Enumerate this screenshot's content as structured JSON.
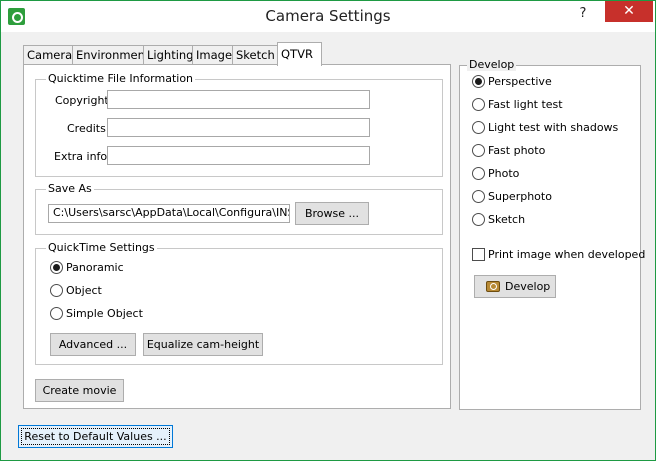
{
  "window": {
    "title": "Camera Settings",
    "help_label": "?",
    "close_label": "✕"
  },
  "tabs": [
    "Camera",
    "Environment",
    "Lighting",
    "Image",
    "Sketch",
    "QTVR"
  ],
  "qtvr": {
    "file_info": {
      "group_label": "Quicktime File Information",
      "copyright_label": "Copyright",
      "copyright_value": "",
      "credits_label": "Credits",
      "credits_value": "",
      "extra_label": "Extra info",
      "extra_value": ""
    },
    "save_as": {
      "group_label": "Save As",
      "path_value": "C:\\Users\\sarsc\\AppData\\Local\\Configura\\INSTPL",
      "browse_label": "Browse ..."
    },
    "settings": {
      "group_label": "QuickTime Settings",
      "options": [
        "Panoramic",
        "Object",
        "Simple Object"
      ],
      "selected": "Panoramic",
      "advanced_label": "Advanced ...",
      "equalize_label": "Equalize cam-height"
    },
    "create_movie_label": "Create movie"
  },
  "develop": {
    "group_label": "Develop",
    "options": [
      "Perspective",
      "Fast light test",
      "Light test with shadows",
      "Fast photo",
      "Photo",
      "Superphoto",
      "Sketch"
    ],
    "selected": "Perspective",
    "print_label": "Print image when developed",
    "print_checked": false,
    "develop_label": "Develop"
  },
  "reset_label": "Reset to Default Values ..."
}
